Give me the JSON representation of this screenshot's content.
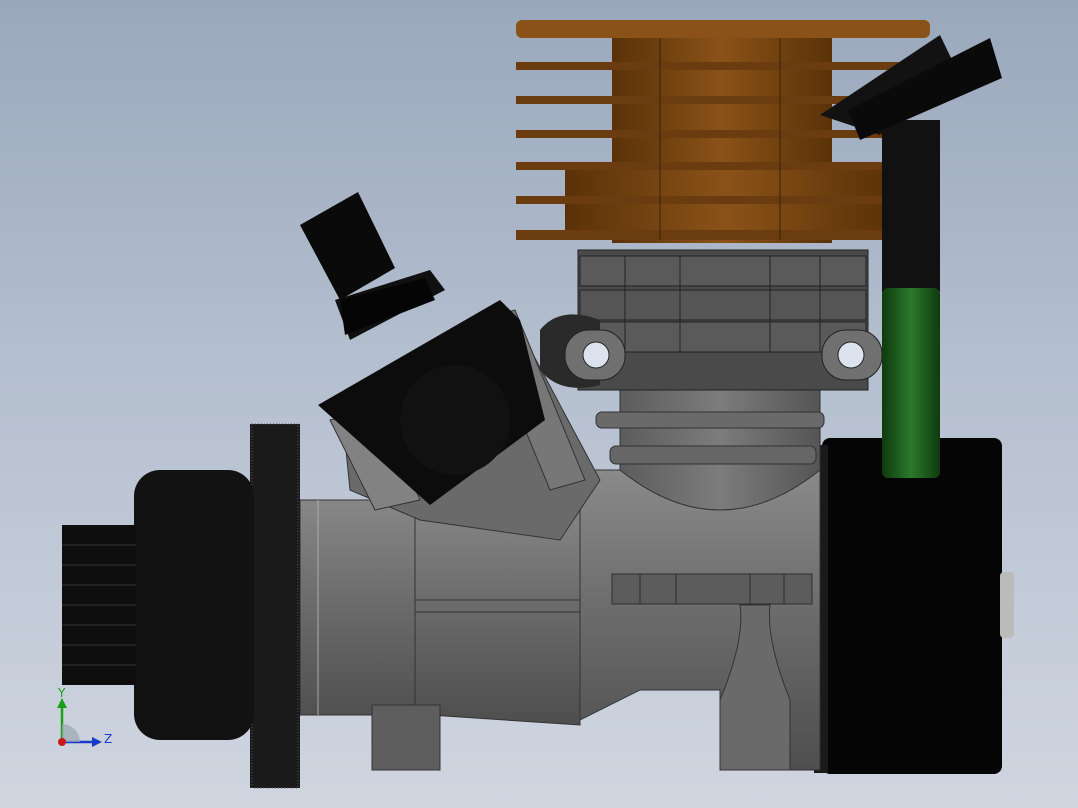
{
  "viewport": {
    "background_top": "#9aa8bc",
    "background_bottom": "#d0d6e0"
  },
  "model": {
    "colors": {
      "cylinder_head": "#7a4612",
      "crankcase": "#6e6e6e",
      "dark_parts": "#0a0a0a",
      "fuel_line_green": "#1e5a1e",
      "flywheel": "#1a1a1a"
    }
  },
  "triad": {
    "y_label": "Y",
    "z_label": "Z",
    "colors": {
      "y": "#1aa01a",
      "z": "#1a3ac8",
      "origin": "#c81a1a"
    }
  }
}
